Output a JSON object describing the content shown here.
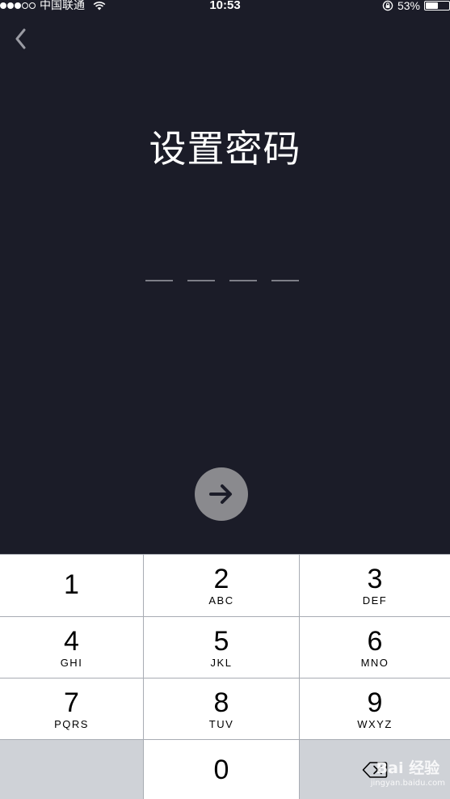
{
  "status_bar": {
    "signal": "●●●○○",
    "carrier": "中国联通",
    "time": "10:53",
    "battery_percent": "53%",
    "battery_level": 0.53
  },
  "header": {
    "back_icon": "chevron-left-icon",
    "title": "设置密码"
  },
  "pin": {
    "length": 4,
    "entered": 0
  },
  "next_button": {
    "icon": "arrow-right-icon",
    "color": "#8a8a8e"
  },
  "keypad": {
    "keys": [
      {
        "digit": "1",
        "letters": ""
      },
      {
        "digit": "2",
        "letters": "ABC"
      },
      {
        "digit": "3",
        "letters": "DEF"
      },
      {
        "digit": "4",
        "letters": "GHI"
      },
      {
        "digit": "5",
        "letters": "JKL"
      },
      {
        "digit": "6",
        "letters": "MNO"
      },
      {
        "digit": "7",
        "letters": "PQRS"
      },
      {
        "digit": "8",
        "letters": "TUV"
      },
      {
        "digit": "9",
        "letters": "WXYZ"
      },
      {
        "digit": "0",
        "letters": ""
      }
    ],
    "delete_icon": "backspace-icon"
  },
  "watermark": {
    "main": "Bai 经验",
    "sub": "jingyan.baidu.com"
  },
  "colors": {
    "background": "#1b1c28",
    "keypad_key": "#ffffff",
    "keypad_special": "#cfd2d7"
  }
}
